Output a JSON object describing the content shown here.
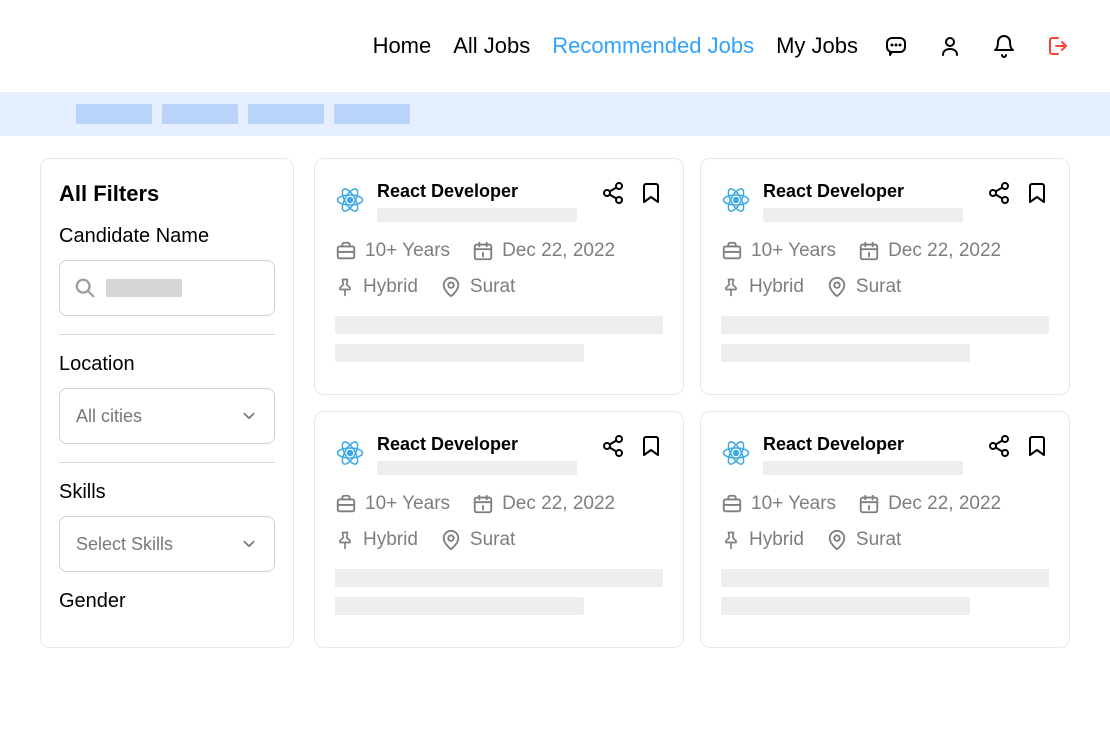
{
  "nav": {
    "home": "Home",
    "all_jobs": "All Jobs",
    "recommended": "Recommended Jobs",
    "my_jobs": "My Jobs"
  },
  "filters": {
    "title": "All Filters",
    "candidate_name_label": "Candidate Name",
    "location_label": "Location",
    "location_value": "All cities",
    "skills_label": "Skills",
    "skills_value": "Select Skills",
    "gender_label": "Gender"
  },
  "jobs": [
    {
      "title": "React Developer",
      "experience": "10+ Years",
      "date": "Dec 22, 2022",
      "mode": "Hybrid",
      "location": "Surat"
    },
    {
      "title": "React Developer",
      "experience": "10+ Years",
      "date": "Dec 22, 2022",
      "mode": "Hybrid",
      "location": "Surat"
    },
    {
      "title": "React Developer",
      "experience": "10+ Years",
      "date": "Dec 22, 2022",
      "mode": "Hybrid",
      "location": "Surat"
    },
    {
      "title": "React Developer",
      "experience": "10+ Years",
      "date": "Dec 22, 2022",
      "mode": "Hybrid",
      "location": "Surat"
    }
  ],
  "icons": {
    "search": "search-icon",
    "chat": "chat-icon",
    "user": "user-icon",
    "bell": "bell-icon",
    "logout": "logout-icon"
  }
}
